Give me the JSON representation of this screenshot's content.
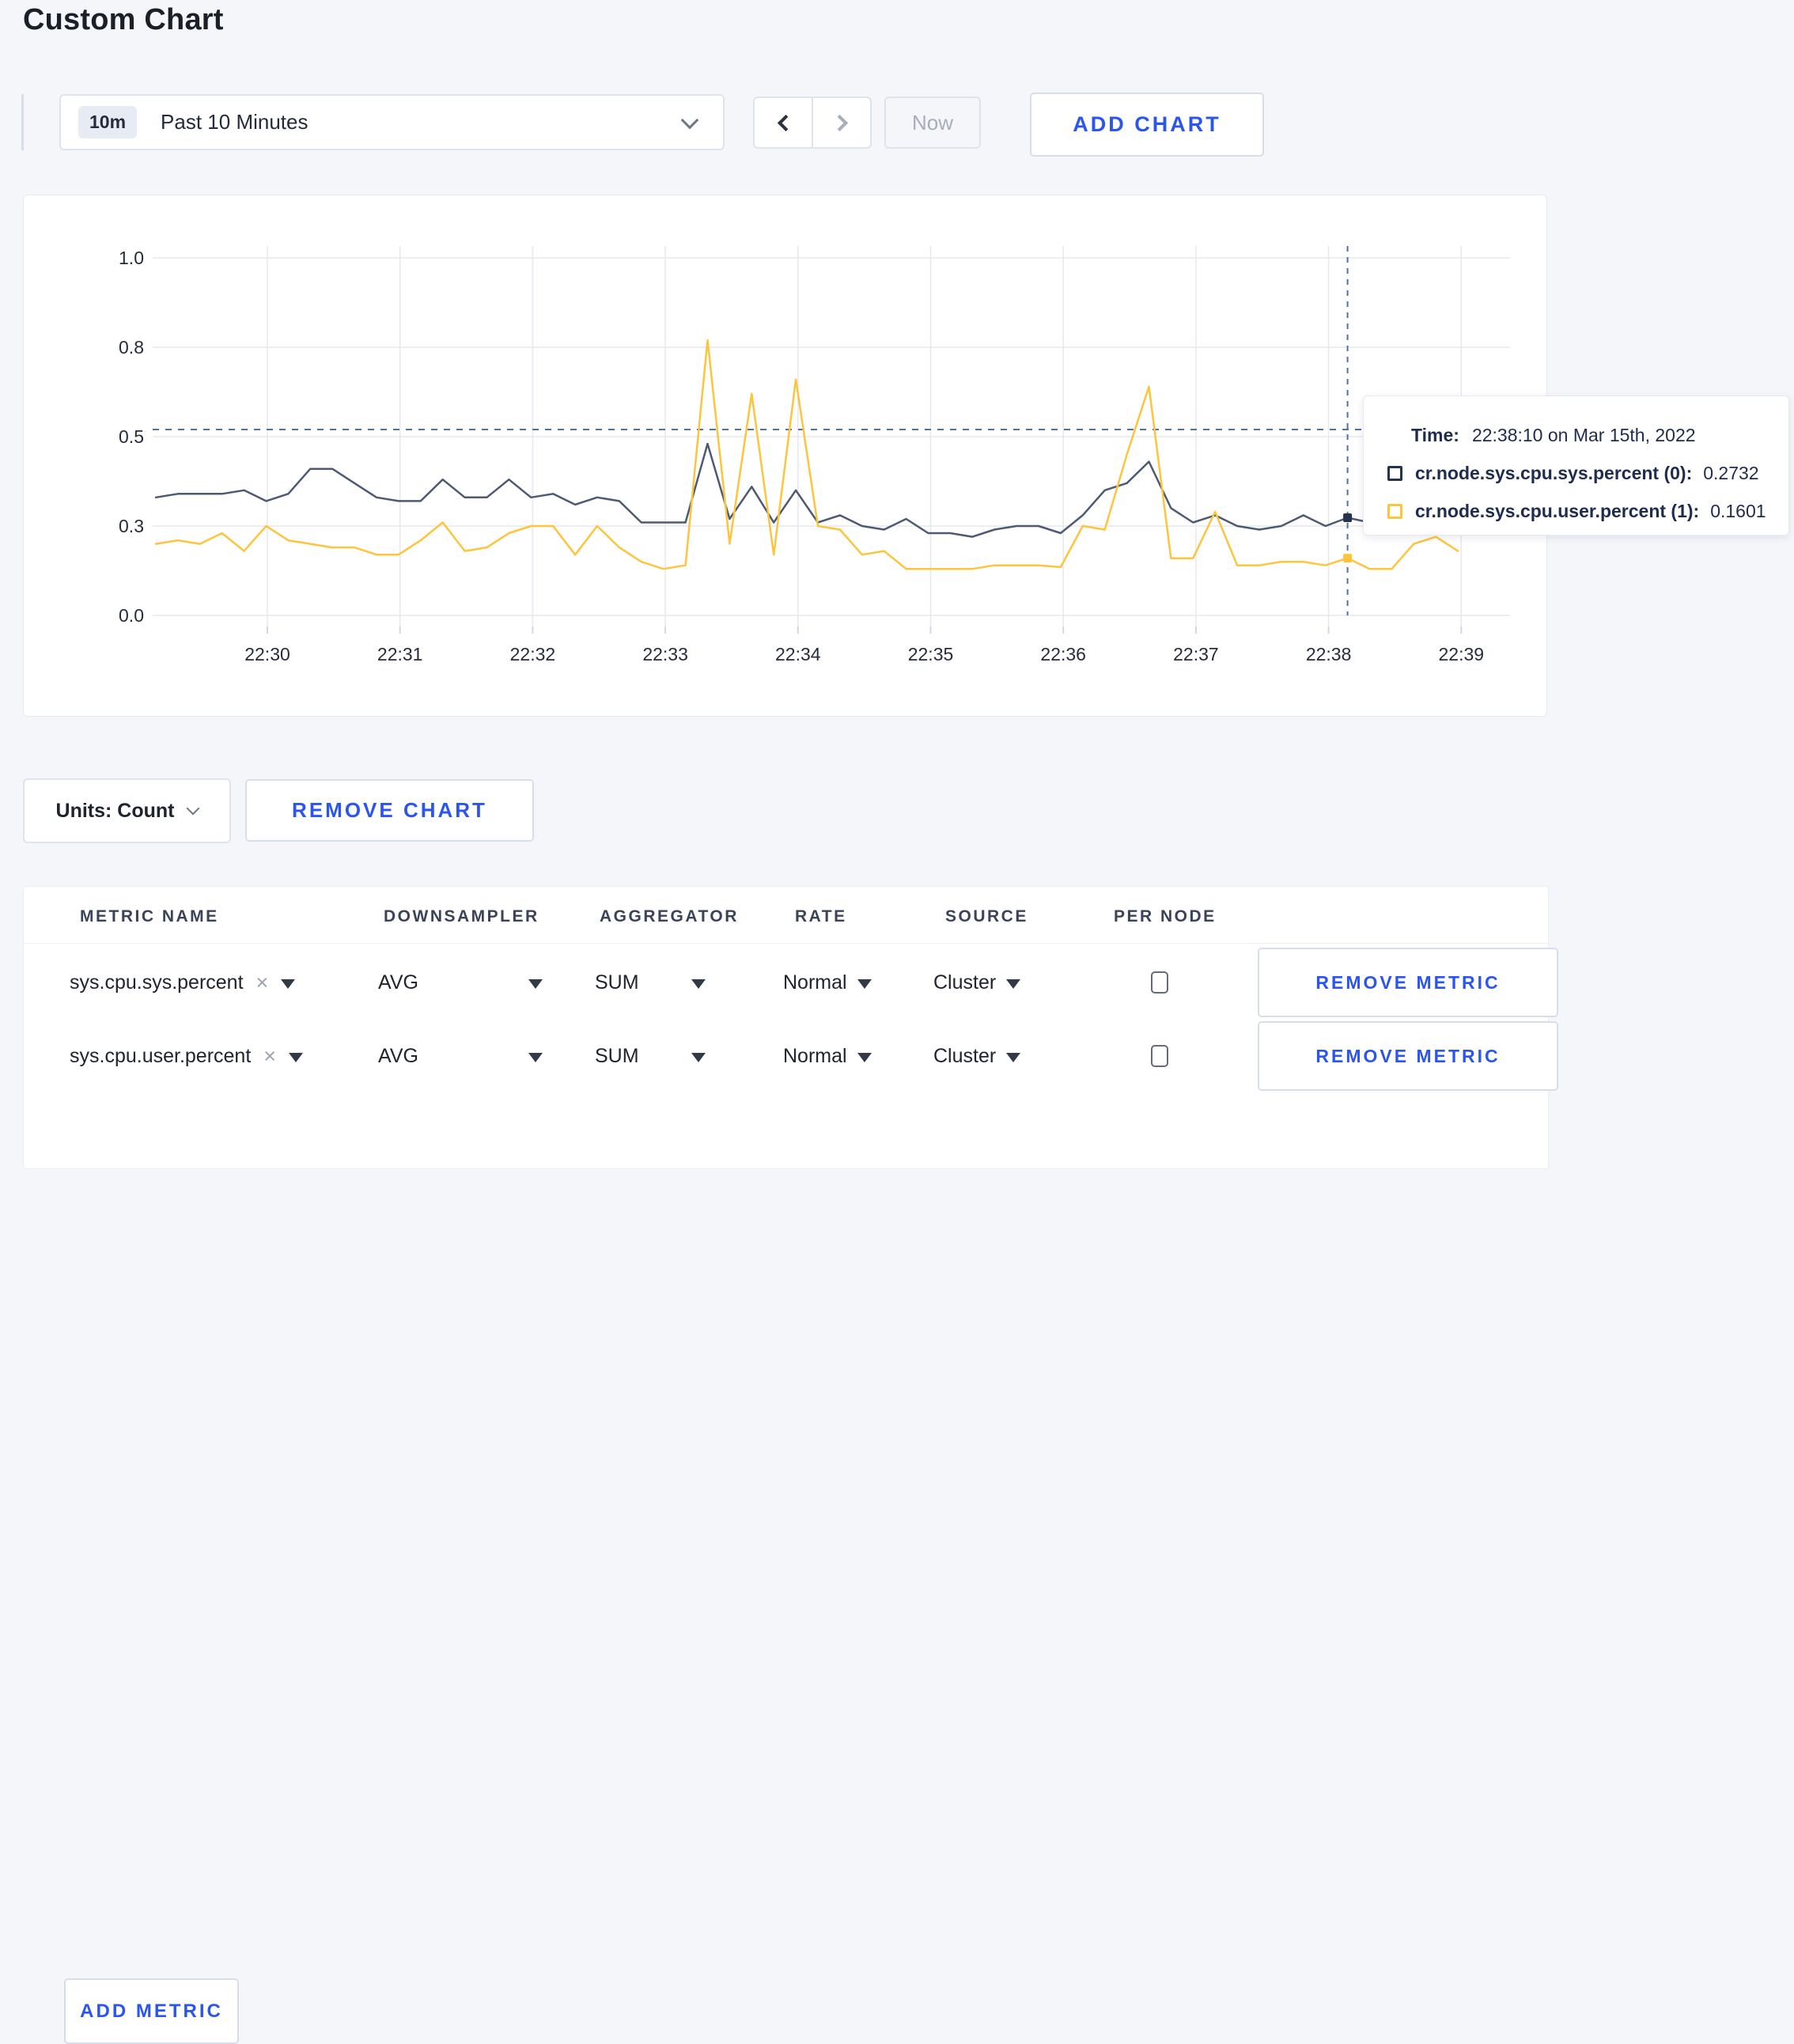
{
  "page": {
    "title": "Custom Chart",
    "background": "#f4f6fa",
    "accent_blue": "#2b55f0"
  },
  "toolbar": {
    "time_range": {
      "badge": "10m",
      "label": "Past 10 Minutes"
    },
    "now_label": "Now",
    "add_chart_label": "ADD CHART"
  },
  "chart_data": {
    "type": "line",
    "x_tick_labels": [
      "22:30",
      "22:31",
      "22:32",
      "22:33",
      "22:34",
      "22:35",
      "22:36",
      "22:37",
      "22:38",
      "22:39"
    ],
    "y_tick_labels": [
      "0.0",
      "0.3",
      "0.5",
      "0.8",
      "1.0"
    ],
    "y_tick_values": [
      0,
      0.25,
      0.5,
      0.75,
      1.0
    ],
    "ylim": [
      0,
      1
    ],
    "x_start_time": "22:29:10",
    "x_interval_seconds": 10,
    "grid": true,
    "series": [
      {
        "name": "cr.node.sys.cpu.sys.percent (0)",
        "color": "#4e5a74",
        "values": [
          0.33,
          0.34,
          0.34,
          0.34,
          0.35,
          0.32,
          0.34,
          0.41,
          0.41,
          0.37,
          0.33,
          0.32,
          0.32,
          0.38,
          0.33,
          0.33,
          0.38,
          0.33,
          0.34,
          0.31,
          0.33,
          0.32,
          0.26,
          0.26,
          0.26,
          0.48,
          0.27,
          0.36,
          0.26,
          0.35,
          0.26,
          0.28,
          0.25,
          0.24,
          0.27,
          0.23,
          0.23,
          0.22,
          0.24,
          0.25,
          0.25,
          0.23,
          0.28,
          0.35,
          0.37,
          0.43,
          0.3,
          0.26,
          0.28,
          0.25,
          0.24,
          0.25,
          0.28,
          0.25,
          0.2732,
          0.26,
          0.27,
          0.28,
          0.3,
          0.3
        ]
      },
      {
        "name": "cr.node.sys.cpu.user.percent (1)",
        "color": "#fcc53d",
        "values": [
          0.2,
          0.21,
          0.2,
          0.23,
          0.18,
          0.25,
          0.21,
          0.2,
          0.19,
          0.19,
          0.17,
          0.17,
          0.21,
          0.26,
          0.18,
          0.19,
          0.23,
          0.25,
          0.25,
          0.17,
          0.25,
          0.19,
          0.15,
          0.13,
          0.14,
          0.77,
          0.2,
          0.62,
          0.17,
          0.66,
          0.25,
          0.24,
          0.17,
          0.18,
          0.13,
          0.13,
          0.13,
          0.13,
          0.14,
          0.14,
          0.14,
          0.135,
          0.25,
          0.24,
          0.45,
          0.64,
          0.16,
          0.16,
          0.29,
          0.14,
          0.14,
          0.15,
          0.15,
          0.14,
          0.1601,
          0.13,
          0.13,
          0.2,
          0.22,
          0.18
        ]
      }
    ],
    "crosshair": {
      "index": 54,
      "time": "22:38:10",
      "hover_line_value": 0.52
    }
  },
  "tooltip": {
    "time_label": "Time:",
    "time_value": "22:38:10 on Mar 15th, 2022",
    "rows": [
      {
        "swatch_color": "#26334d",
        "label": "cr.node.sys.cpu.sys.percent (0):",
        "value": "0.2732"
      },
      {
        "swatch_color": "#fcc53d",
        "label": "cr.node.sys.cpu.user.percent (1):",
        "value": "0.1601"
      }
    ]
  },
  "footer": {
    "units_label": "Units: Count",
    "remove_chart_label": "REMOVE CHART"
  },
  "icons": {
    "clear": "×"
  },
  "metrics_table": {
    "headers": [
      "METRIC NAME",
      "DOWNSAMPLER",
      "AGGREGATOR",
      "RATE",
      "SOURCE",
      "PER NODE"
    ],
    "rows": [
      {
        "metric": "sys.cpu.sys.percent",
        "downsampler": "AVG",
        "aggregator": "SUM",
        "rate": "Normal",
        "source": "Cluster",
        "per_node_checked": false,
        "remove_label": "REMOVE METRIC"
      },
      {
        "metric": "sys.cpu.user.percent",
        "downsampler": "AVG",
        "aggregator": "SUM",
        "rate": "Normal",
        "source": "Cluster",
        "per_node_checked": false,
        "remove_label": "REMOVE METRIC"
      }
    ],
    "add_metric_label": "ADD METRIC"
  }
}
